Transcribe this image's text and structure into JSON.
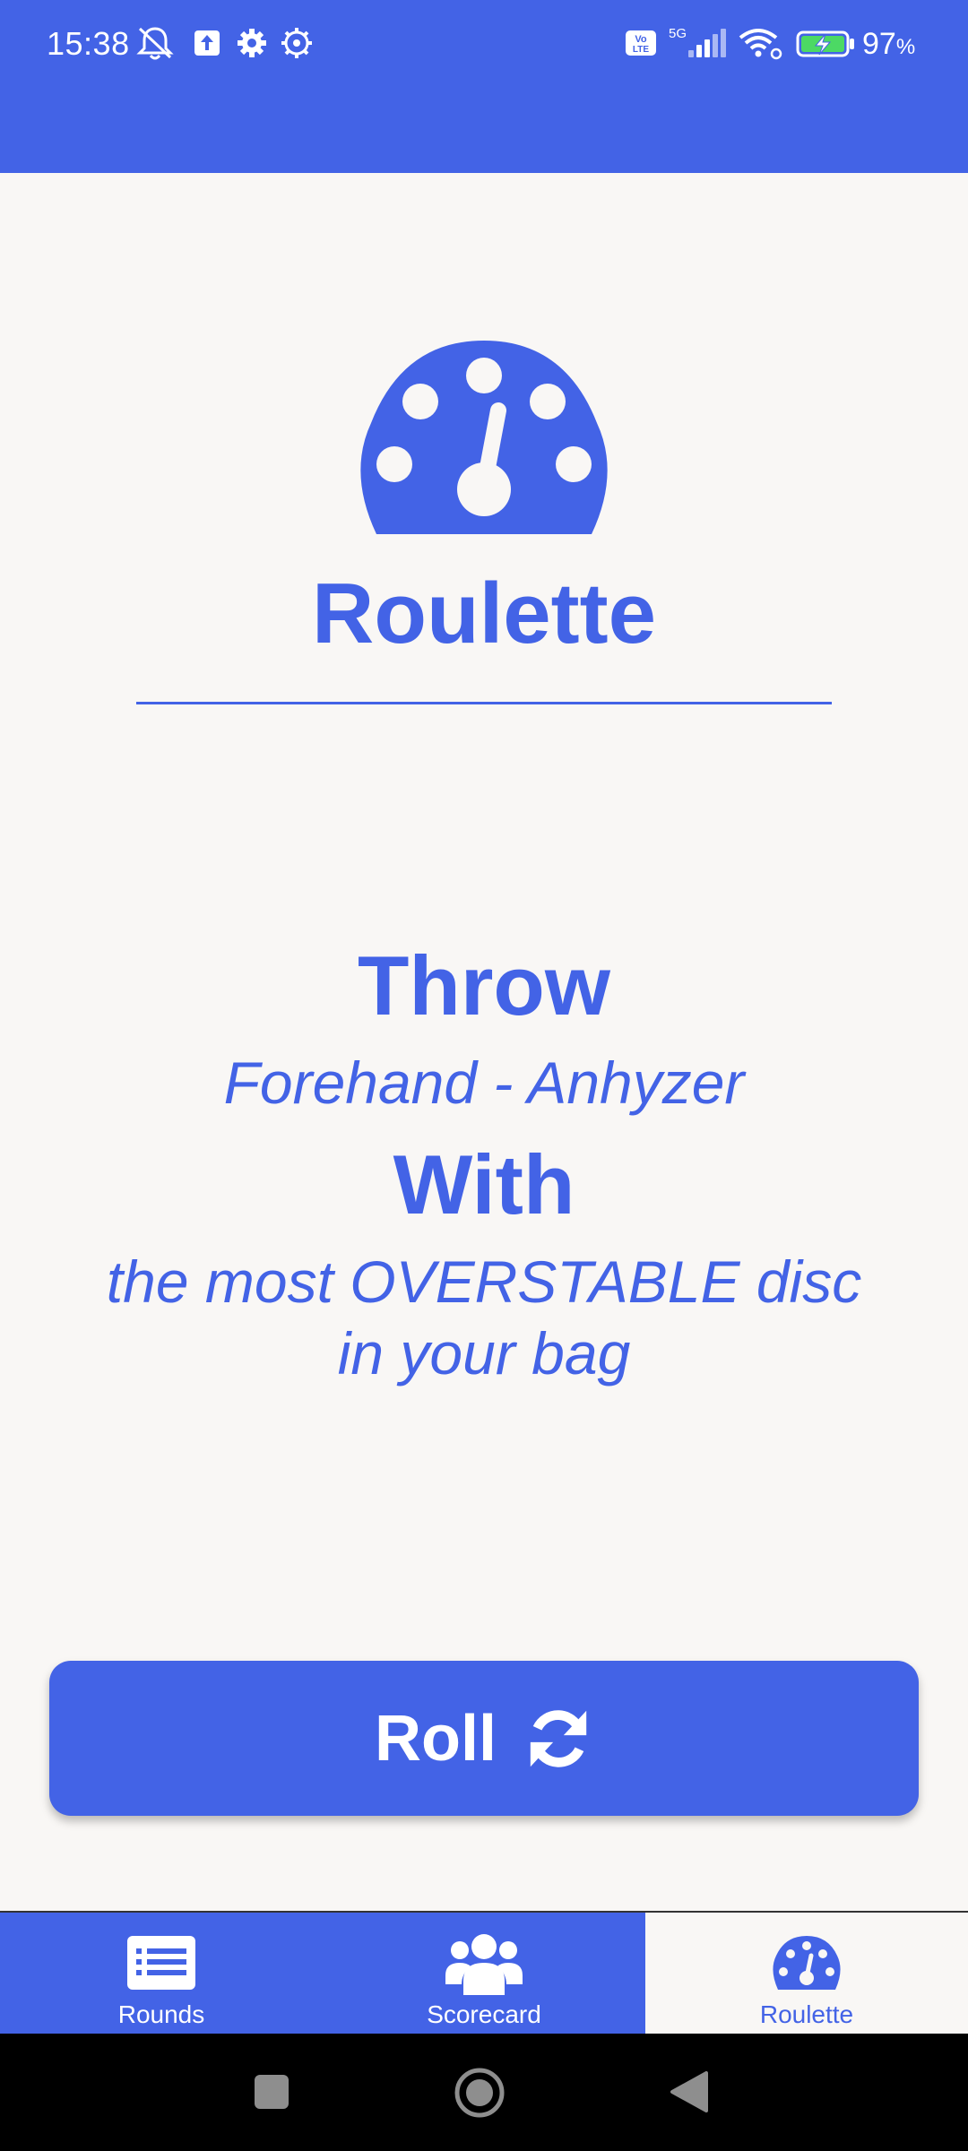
{
  "status_bar": {
    "time": "15:38",
    "battery_percent": "97",
    "battery_unit": "%",
    "network": "5G",
    "volte": "Vo LTE",
    "icons": [
      "mute-icon",
      "upload-icon",
      "settings-icon",
      "gear-outline-icon",
      "volte-icon",
      "signal-icon",
      "wifi-icon",
      "battery-charging-icon"
    ]
  },
  "header": {
    "icon": "gauge-icon",
    "title": "Roulette"
  },
  "result": {
    "throw_label": "Throw",
    "throw_value": "Forehand - Anhyzer",
    "with_label": "With",
    "with_value_line1": "the most OVERSTABLE disc",
    "with_value_line2": "in your bag"
  },
  "actions": {
    "roll_label": "Roll",
    "roll_icon": "refresh-icon"
  },
  "bottom_nav": {
    "items": [
      {
        "label": "Rounds",
        "icon": "list-icon",
        "active": false
      },
      {
        "label": "Scorecard",
        "icon": "users-icon",
        "active": false
      },
      {
        "label": "Roulette",
        "icon": "gauge-icon",
        "active": true
      }
    ]
  },
  "system_nav": {
    "buttons": [
      "recents-square-icon",
      "home-circle-icon",
      "back-triangle-icon"
    ]
  },
  "colors": {
    "accent": "#4363e6",
    "background": "#f9f7f5",
    "on_accent": "#ffffff"
  }
}
